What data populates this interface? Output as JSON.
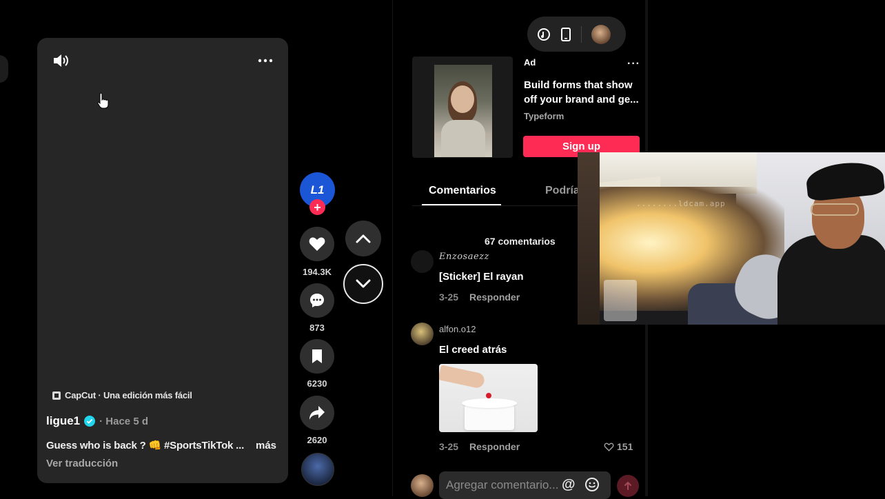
{
  "video": {
    "capcut_label": "CapCut · Una edición más fácil",
    "author": "ligue1",
    "posted": "· Hace 5 d",
    "caption": "Guess who is back ? 👊 #SportsTikTok ...",
    "more_label": "más",
    "translate_label": "Ver traducción"
  },
  "actions": {
    "avatar_text": "L1",
    "likes": "194.3K",
    "comments": "873",
    "saves": "6230",
    "shares": "2620"
  },
  "ad": {
    "label": "Ad",
    "more": "···",
    "title_line1": "Build forms that show",
    "title_line2": "off your brand and ge...",
    "brand": "Typeform",
    "cta": "Sign up"
  },
  "tabs": {
    "comments": "Comentarios",
    "other": "Podría"
  },
  "comments": {
    "count_label": "67 comentarios",
    "items": [
      {
        "user": "Enzosaezz",
        "text": "[Sticker] El rayan",
        "date": "3-25",
        "reply": "Responder"
      },
      {
        "user": "alfon.o12",
        "text": "El creed atrás",
        "date": "3-25",
        "reply": "Responder",
        "likes": "151"
      }
    ]
  },
  "input": {
    "placeholder": "Agregar comentario...",
    "at_symbol": "@"
  },
  "webcam": {
    "watermark": "........ldcam.app"
  },
  "colors": {
    "accent": "#fe2c55",
    "verified": "#20d5ec",
    "card": "#262626",
    "button": "#2f2f2f"
  }
}
